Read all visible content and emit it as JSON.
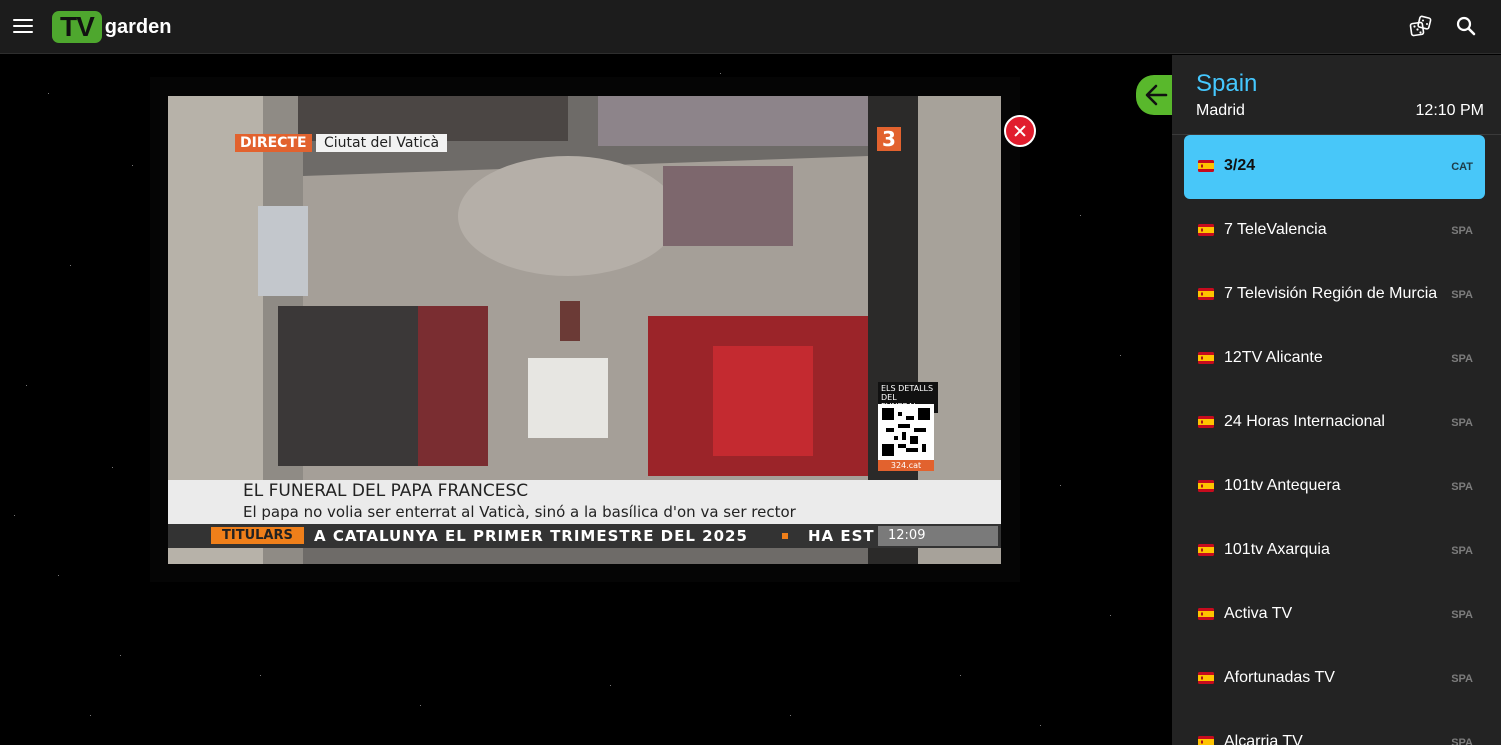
{
  "app": {
    "logo_badge": "TV",
    "logo_word": "garden"
  },
  "header": {
    "icons": [
      "menu-icon",
      "dice-icon",
      "search-icon"
    ]
  },
  "player": {
    "live_badge": "DIRECTE",
    "location_text": "Ciutat del Vaticà",
    "channel_logo": "3",
    "qr_caption_1": "ELS DETALLS",
    "qr_caption_2": "DEL FUNERAL",
    "qr_url": "324.cat",
    "headline": "EL FUNERAL DEL PAPA FRANCESC",
    "subheadline": "El papa no volia ser enterrat al Vaticà, sinó a la basílica d'on va ser rector",
    "ticker_label": "TITULARS",
    "ticker_text": "A CATALUNYA EL PRIMER TRIMESTRE DEL 2025",
    "ticker_tail": "HA EST",
    "ticker_time": "12:09"
  },
  "sidebar": {
    "country": "Spain",
    "city": "Madrid",
    "time": "12:10 PM",
    "channels": [
      {
        "name": "3/24",
        "lang": "CAT",
        "active": true
      },
      {
        "name": "7 TeleValencia",
        "lang": "SPA"
      },
      {
        "name": "7 Televisión Región de Murcia",
        "lang": "SPA"
      },
      {
        "name": "12TV Alicante",
        "lang": "SPA"
      },
      {
        "name": "24 Horas Internacional",
        "lang": "SPA"
      },
      {
        "name": "101tv Antequera",
        "lang": "SPA"
      },
      {
        "name": "101tv Axarquia",
        "lang": "SPA"
      },
      {
        "name": "Activa TV",
        "lang": "SPA"
      },
      {
        "name": "Afortunadas TV",
        "lang": "SPA"
      },
      {
        "name": "Alcarria TV",
        "lang": "SPA"
      }
    ]
  },
  "colors": {
    "accent": "#48c7f9",
    "brand": "#4ea72e",
    "close": "#e11d2e",
    "country": "#45c8ff"
  }
}
